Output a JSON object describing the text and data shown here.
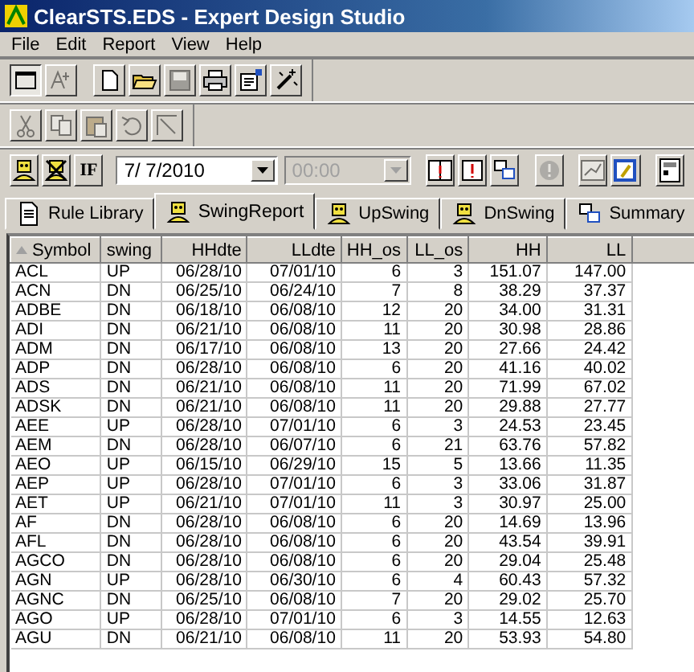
{
  "window": {
    "title": "ClearSTS.EDS - Expert Design Studio"
  },
  "menu": [
    "File",
    "Edit",
    "Report",
    "View",
    "Help"
  ],
  "toolbars": [
    [
      {
        "kind": "frame",
        "disabled": false,
        "pressed": true
      },
      {
        "kind": "text",
        "disabled": true,
        "pressed": false
      },
      {
        "kind": "gap"
      },
      {
        "kind": "new",
        "disabled": false,
        "pressed": false
      },
      {
        "kind": "open",
        "disabled": false,
        "pressed": false
      },
      {
        "kind": "save",
        "disabled": true,
        "pressed": false
      },
      {
        "kind": "print",
        "disabled": false,
        "pressed": false
      },
      {
        "kind": "props",
        "disabled": false,
        "pressed": false
      },
      {
        "kind": "wand",
        "disabled": false,
        "pressed": false
      }
    ],
    [
      {
        "kind": "cut",
        "disabled": true,
        "pressed": false
      },
      {
        "kind": "copy",
        "disabled": true,
        "pressed": false
      },
      {
        "kind": "paste",
        "disabled": true,
        "pressed": false
      },
      {
        "kind": "undo",
        "disabled": true,
        "pressed": false
      },
      {
        "kind": "corner",
        "disabled": true,
        "pressed": false
      }
    ]
  ],
  "report_bar": {
    "run_disabled": false,
    "stop_disabled": false,
    "if_label": "IF",
    "date": "7/ 7/2010",
    "time": "00:00",
    "time_disabled": true,
    "buttons": [
      {
        "kind": "alert-docs",
        "disabled": false
      },
      {
        "kind": "alert-doc",
        "disabled": false
      },
      {
        "kind": "windows",
        "disabled": false
      },
      {
        "kind": "gap"
      },
      {
        "kind": "exclaim",
        "disabled": true
      },
      {
        "kind": "gap"
      },
      {
        "kind": "chart",
        "disabled": true
      },
      {
        "kind": "edit",
        "disabled": false
      },
      {
        "kind": "gap"
      },
      {
        "kind": "panel",
        "disabled": false
      }
    ]
  },
  "tabs": [
    {
      "label": "Rule Library",
      "kind": "doc",
      "selected": false
    },
    {
      "label": "SwingReport",
      "kind": "person",
      "selected": true
    },
    {
      "label": "UpSwing",
      "kind": "person",
      "selected": false
    },
    {
      "label": "DnSwing",
      "kind": "person",
      "selected": false
    },
    {
      "label": "Summary",
      "kind": "windows",
      "selected": false
    }
  ],
  "table": {
    "columns": [
      {
        "label": "Symbol",
        "sorted": true
      },
      {
        "label": "swing",
        "sorted": false
      },
      {
        "label": "HHdte",
        "sorted": false
      },
      {
        "label": "LLdte",
        "sorted": false
      },
      {
        "label": "HH_os",
        "sorted": false
      },
      {
        "label": "LL_os",
        "sorted": false
      },
      {
        "label": "HH",
        "sorted": false
      },
      {
        "label": "LL",
        "sorted": false
      }
    ],
    "rows": [
      [
        "ACL",
        "UP",
        "06/28/10",
        "07/01/10",
        "6",
        "3",
        "151.07",
        "147.00"
      ],
      [
        "ACN",
        "DN",
        "06/25/10",
        "06/24/10",
        "7",
        "8",
        "38.29",
        "37.37"
      ],
      [
        "ADBE",
        "DN",
        "06/18/10",
        "06/08/10",
        "12",
        "20",
        "34.00",
        "31.31"
      ],
      [
        "ADI",
        "DN",
        "06/21/10",
        "06/08/10",
        "11",
        "20",
        "30.98",
        "28.86"
      ],
      [
        "ADM",
        "DN",
        "06/17/10",
        "06/08/10",
        "13",
        "20",
        "27.66",
        "24.42"
      ],
      [
        "ADP",
        "DN",
        "06/28/10",
        "06/08/10",
        "6",
        "20",
        "41.16",
        "40.02"
      ],
      [
        "ADS",
        "DN",
        "06/21/10",
        "06/08/10",
        "11",
        "20",
        "71.99",
        "67.02"
      ],
      [
        "ADSK",
        "DN",
        "06/21/10",
        "06/08/10",
        "11",
        "20",
        "29.88",
        "27.77"
      ],
      [
        "AEE",
        "UP",
        "06/28/10",
        "07/01/10",
        "6",
        "3",
        "24.53",
        "23.45"
      ],
      [
        "AEM",
        "DN",
        "06/28/10",
        "06/07/10",
        "6",
        "21",
        "63.76",
        "57.82"
      ],
      [
        "AEO",
        "UP",
        "06/15/10",
        "06/29/10",
        "15",
        "5",
        "13.66",
        "11.35"
      ],
      [
        "AEP",
        "UP",
        "06/28/10",
        "07/01/10",
        "6",
        "3",
        "33.06",
        "31.87"
      ],
      [
        "AET",
        "UP",
        "06/21/10",
        "07/01/10",
        "11",
        "3",
        "30.97",
        "25.00"
      ],
      [
        "AF",
        "DN",
        "06/28/10",
        "06/08/10",
        "6",
        "20",
        "14.69",
        "13.96"
      ],
      [
        "AFL",
        "DN",
        "06/28/10",
        "06/08/10",
        "6",
        "20",
        "43.54",
        "39.91"
      ],
      [
        "AGCO",
        "DN",
        "06/28/10",
        "06/08/10",
        "6",
        "20",
        "29.04",
        "25.48"
      ],
      [
        "AGN",
        "UP",
        "06/28/10",
        "06/30/10",
        "6",
        "4",
        "60.43",
        "57.32"
      ],
      [
        "AGNC",
        "DN",
        "06/25/10",
        "06/08/10",
        "7",
        "20",
        "29.02",
        "25.70"
      ],
      [
        "AGO",
        "UP",
        "06/28/10",
        "07/01/10",
        "6",
        "3",
        "14.55",
        "12.63"
      ],
      [
        "AGU",
        "DN",
        "06/21/10",
        "06/08/10",
        "11",
        "20",
        "53.93",
        "54.80"
      ]
    ]
  }
}
